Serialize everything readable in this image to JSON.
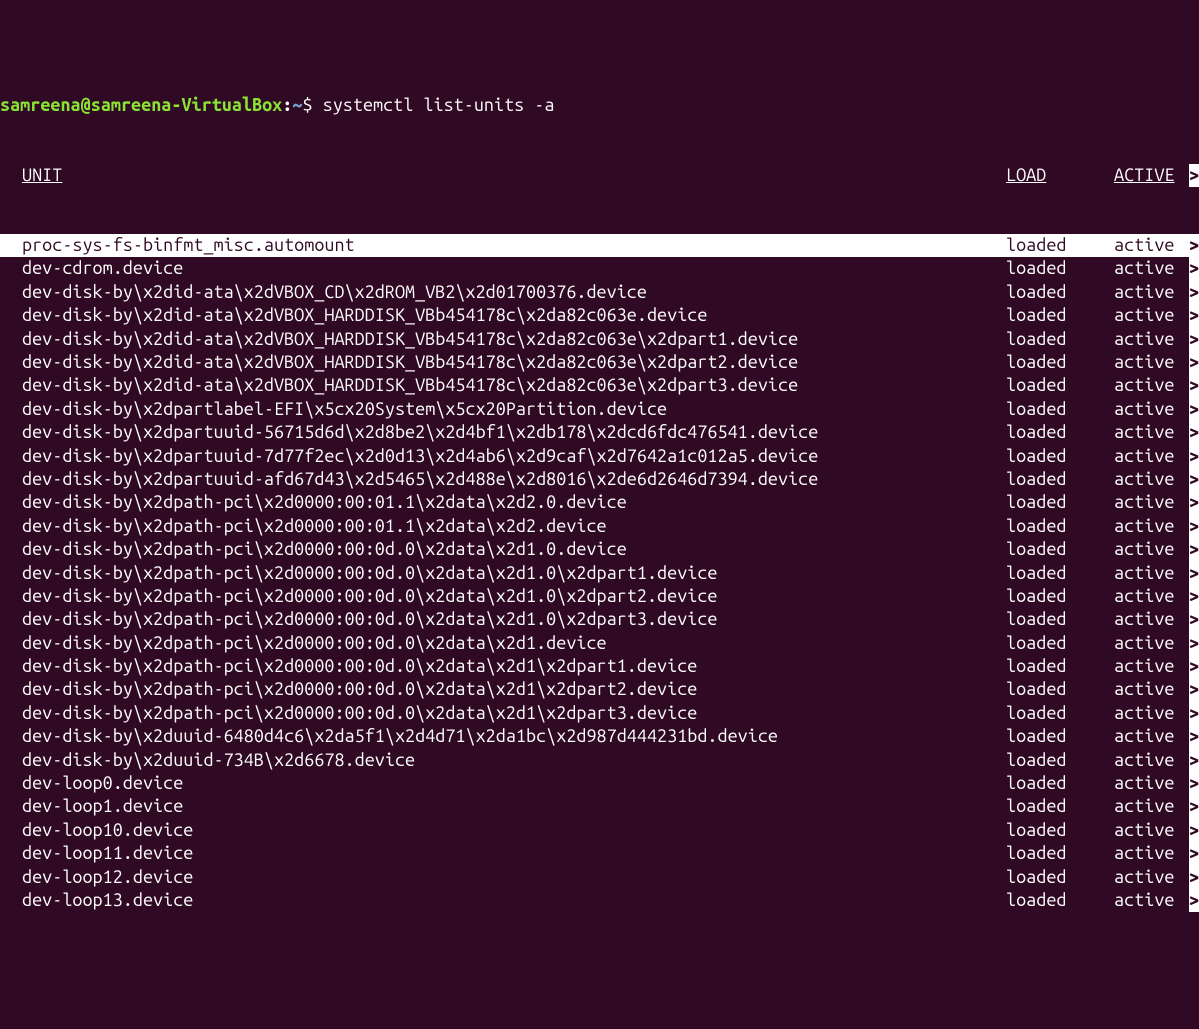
{
  "prompt": {
    "user": "samreena",
    "at": "@",
    "host": "samreena-VirtualBox",
    "colon": ":",
    "path": "~",
    "dollar": "$",
    "command": " systemctl list-units -a"
  },
  "header": {
    "unit": "UNIT",
    "load": "LOAD",
    "active": "ACTIVE"
  },
  "arrow": ">",
  "rows": [
    {
      "unit": "proc-sys-fs-binfmt_misc.automount",
      "load": "loaded",
      "active": "active",
      "hl": true
    },
    {
      "unit": "dev-cdrom.device",
      "load": "loaded",
      "active": "active"
    },
    {
      "unit": "dev-disk-by\\x2did-ata\\x2dVBOX_CD\\x2dROM_VB2\\x2d01700376.device",
      "load": "loaded",
      "active": "active"
    },
    {
      "unit": "dev-disk-by\\x2did-ata\\x2dVBOX_HARDDISK_VBb454178c\\x2da82c063e.device",
      "load": "loaded",
      "active": "active"
    },
    {
      "unit": "dev-disk-by\\x2did-ata\\x2dVBOX_HARDDISK_VBb454178c\\x2da82c063e\\x2dpart1.device",
      "load": "loaded",
      "active": "active"
    },
    {
      "unit": "dev-disk-by\\x2did-ata\\x2dVBOX_HARDDISK_VBb454178c\\x2da82c063e\\x2dpart2.device",
      "load": "loaded",
      "active": "active"
    },
    {
      "unit": "dev-disk-by\\x2did-ata\\x2dVBOX_HARDDISK_VBb454178c\\x2da82c063e\\x2dpart3.device",
      "load": "loaded",
      "active": "active"
    },
    {
      "unit": "dev-disk-by\\x2dpartlabel-EFI\\x5cx20System\\x5cx20Partition.device",
      "load": "loaded",
      "active": "active"
    },
    {
      "unit": "dev-disk-by\\x2dpartuuid-56715d6d\\x2d8be2\\x2d4bf1\\x2db178\\x2dcd6fdc476541.device",
      "load": "loaded",
      "active": "active"
    },
    {
      "unit": "dev-disk-by\\x2dpartuuid-7d77f2ec\\x2d0d13\\x2d4ab6\\x2d9caf\\x2d7642a1c012a5.device",
      "load": "loaded",
      "active": "active"
    },
    {
      "unit": "dev-disk-by\\x2dpartuuid-afd67d43\\x2d5465\\x2d488e\\x2d8016\\x2de6d2646d7394.device",
      "load": "loaded",
      "active": "active"
    },
    {
      "unit": "dev-disk-by\\x2dpath-pci\\x2d0000:00:01.1\\x2data\\x2d2.0.device",
      "load": "loaded",
      "active": "active"
    },
    {
      "unit": "dev-disk-by\\x2dpath-pci\\x2d0000:00:01.1\\x2data\\x2d2.device",
      "load": "loaded",
      "active": "active"
    },
    {
      "unit": "dev-disk-by\\x2dpath-pci\\x2d0000:00:0d.0\\x2data\\x2d1.0.device",
      "load": "loaded",
      "active": "active"
    },
    {
      "unit": "dev-disk-by\\x2dpath-pci\\x2d0000:00:0d.0\\x2data\\x2d1.0\\x2dpart1.device",
      "load": "loaded",
      "active": "active"
    },
    {
      "unit": "dev-disk-by\\x2dpath-pci\\x2d0000:00:0d.0\\x2data\\x2d1.0\\x2dpart2.device",
      "load": "loaded",
      "active": "active"
    },
    {
      "unit": "dev-disk-by\\x2dpath-pci\\x2d0000:00:0d.0\\x2data\\x2d1.0\\x2dpart3.device",
      "load": "loaded",
      "active": "active"
    },
    {
      "unit": "dev-disk-by\\x2dpath-pci\\x2d0000:00:0d.0\\x2data\\x2d1.device",
      "load": "loaded",
      "active": "active"
    },
    {
      "unit": "dev-disk-by\\x2dpath-pci\\x2d0000:00:0d.0\\x2data\\x2d1\\x2dpart1.device",
      "load": "loaded",
      "active": "active"
    },
    {
      "unit": "dev-disk-by\\x2dpath-pci\\x2d0000:00:0d.0\\x2data\\x2d1\\x2dpart2.device",
      "load": "loaded",
      "active": "active"
    },
    {
      "unit": "dev-disk-by\\x2dpath-pci\\x2d0000:00:0d.0\\x2data\\x2d1\\x2dpart3.device",
      "load": "loaded",
      "active": "active"
    },
    {
      "unit": "dev-disk-by\\x2duuid-6480d4c6\\x2da5f1\\x2d4d71\\x2da1bc\\x2d987d444231bd.device",
      "load": "loaded",
      "active": "active"
    },
    {
      "unit": "dev-disk-by\\x2duuid-734B\\x2d6678.device",
      "load": "loaded",
      "active": "active"
    },
    {
      "unit": "dev-loop0.device",
      "load": "loaded",
      "active": "active"
    },
    {
      "unit": "dev-loop1.device",
      "load": "loaded",
      "active": "active"
    },
    {
      "unit": "dev-loop10.device",
      "load": "loaded",
      "active": "active"
    },
    {
      "unit": "dev-loop11.device",
      "load": "loaded",
      "active": "active"
    },
    {
      "unit": "dev-loop12.device",
      "load": "loaded",
      "active": "active"
    },
    {
      "unit": "dev-loop13.device",
      "load": "loaded",
      "active": "active"
    }
  ]
}
